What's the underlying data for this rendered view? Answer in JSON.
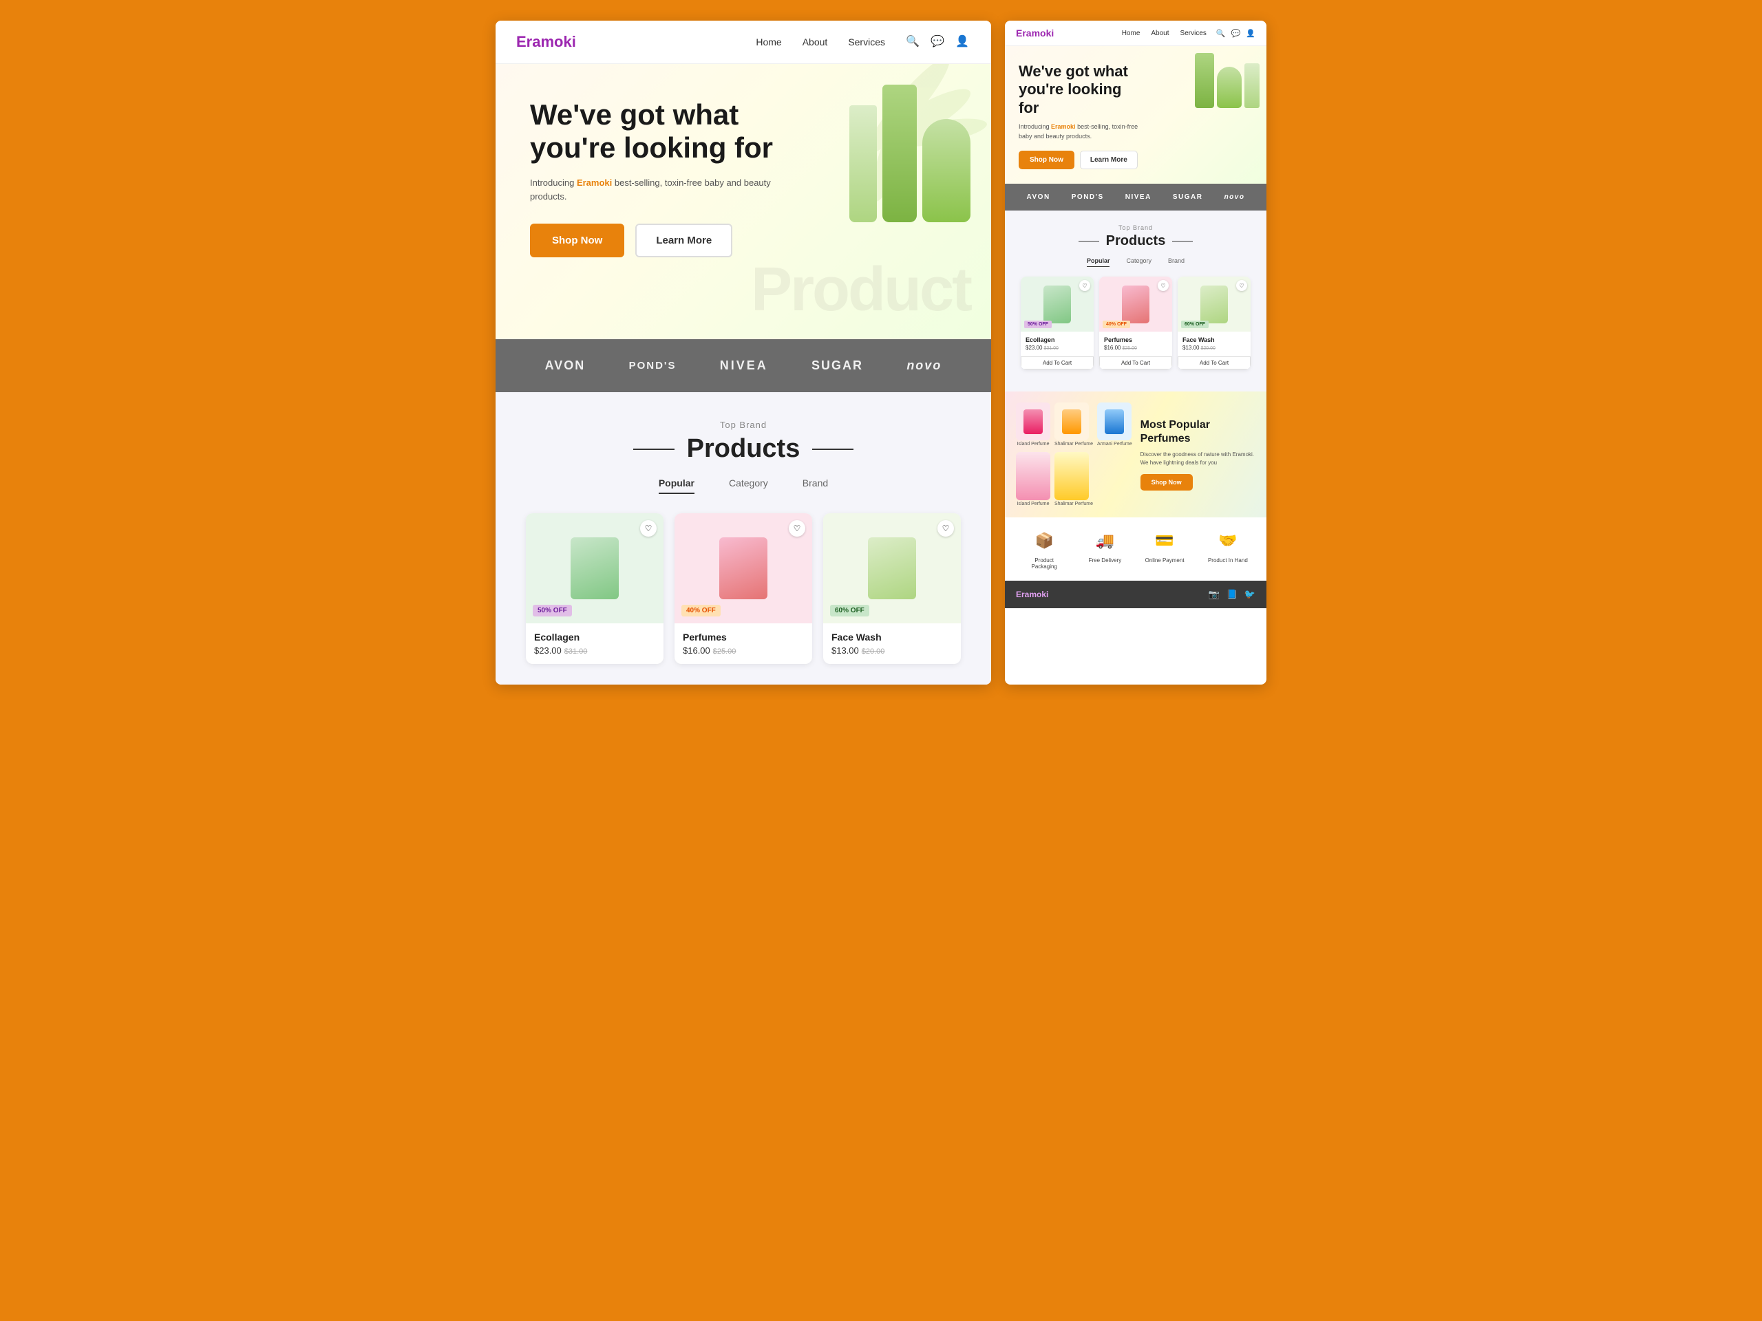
{
  "site": {
    "logo": "Eramoki",
    "nav": {
      "home": "Home",
      "about": "About",
      "services": "Services"
    }
  },
  "hero": {
    "title_line1": "We've got what",
    "title_line2": "you're looking for",
    "subtitle_pre": "Introducing ",
    "brand_name": "Eramoki",
    "subtitle_post": " best-selling, toxin-free baby and beauty products.",
    "btn_shop": "Shop Now",
    "btn_learn": "Learn More",
    "bg_text": "Product"
  },
  "brands": {
    "items": [
      "AVON",
      "POND'S",
      "NIVEA",
      "SUGAR",
      "novo"
    ]
  },
  "products": {
    "section_label": "Top Brand",
    "section_title": "Products",
    "tabs": [
      "Popular",
      "Category",
      "Brand"
    ],
    "cards": [
      {
        "name": "Ecollagen",
        "price": "$23.00",
        "old_price": "$31.00",
        "off": "50% OFF",
        "off_class": "purple",
        "bg": "green"
      },
      {
        "name": "Perfumes",
        "price": "$16.00",
        "old_price": "$25.00",
        "off": "40% OFF",
        "off_class": "orange",
        "bg": "pink"
      },
      {
        "name": "Face Wash",
        "price": "$13.00",
        "old_price": "$20.00",
        "off": "60% OFF",
        "off_class": "green-badge",
        "bg": "light"
      }
    ],
    "add_to_cart": "Add To Cart"
  },
  "perfumes": {
    "title": "Most Popular Perfumes",
    "description": "Discover the goodness of nature with Eramoki. We have lightning deals for you",
    "btn_shop": "Shop Now",
    "items": [
      "Island Perfume",
      "Shalimar Perfume",
      "Armani Perfume"
    ],
    "large_items": [
      "Island Perfume",
      "Shalimar Perfume"
    ]
  },
  "features": [
    {
      "icon": "📦",
      "label": "Product Packaging"
    },
    {
      "icon": "🚚",
      "label": "Free Delivery"
    },
    {
      "icon": "💳",
      "label": "Online Payment"
    },
    {
      "icon": "🤝",
      "label": "Product In Hand"
    }
  ],
  "footer": {
    "logo": "Eramoki",
    "social": [
      "instagram",
      "facebook",
      "twitter"
    ]
  },
  "right_hero": {
    "title_line1": "We've got what",
    "title_line2": "you're looking for",
    "subtitle_pre": "Introducing ",
    "brand_name": "Eramoki",
    "subtitle_post": " best-selling, toxin-free baby and beauty products.",
    "btn_shop": "Shop Now",
    "btn_learn": "Learn More"
  }
}
